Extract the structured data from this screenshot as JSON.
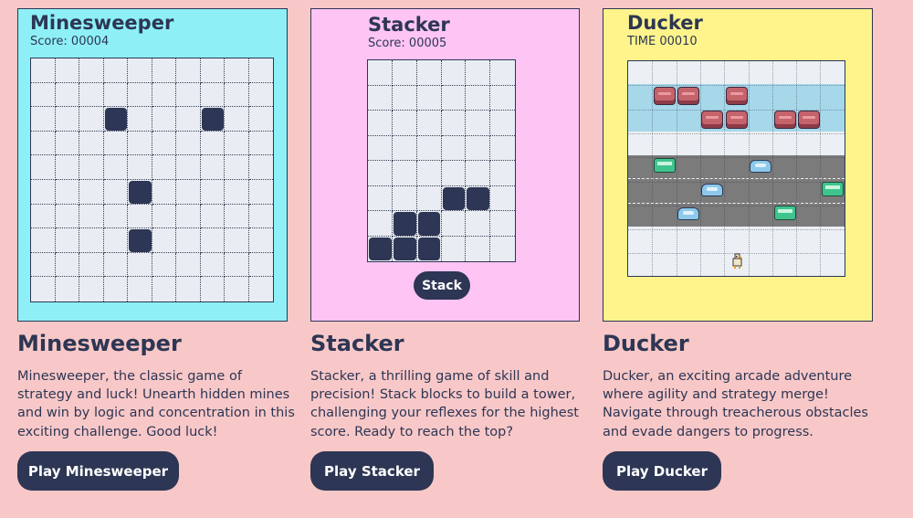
{
  "games": [
    {
      "id": "minesweeper",
      "card_title": "Minesweeper",
      "score_text": "Score: 00004",
      "grid": {
        "cols": 10,
        "rows": 10,
        "filled": [
          [
            2,
            3
          ],
          [
            2,
            7
          ],
          [
            5,
            4
          ],
          [
            7,
            4
          ]
        ]
      },
      "heading": "Minesweeper",
      "description": "Minesweeper, the classic game of strategy and luck! Unearth hidden mines and win by logic and concentration in this exciting challenge. Good luck!",
      "button_label": "Play Minesweeper"
    },
    {
      "id": "stacker",
      "card_title": "Stacker",
      "score_text": "Score: 00005",
      "grid": {
        "cols": 6,
        "rows": 8,
        "filled": [
          [
            5,
            3
          ],
          [
            5,
            4
          ],
          [
            6,
            1
          ],
          [
            6,
            2
          ],
          [
            7,
            0
          ],
          [
            7,
            1
          ],
          [
            7,
            2
          ]
        ]
      },
      "stack_button_label": "Stack",
      "heading": "Stacker",
      "description": "Stacker, a thrilling game of skill and precision! Stack blocks to build a tower, challenging your reflexes for the highest score. Ready to reach the top?",
      "button_label": "Play Stacker"
    },
    {
      "id": "ducker",
      "card_title": "Ducker",
      "score_text": "TIME 00010",
      "heading": "Ducker",
      "description": "Ducker, an exciting arcade adventure where agility and strategy merge! Navigate through treacherous obstacles and evade dangers to progress.",
      "button_label": "Play Ducker"
    }
  ],
  "colors": {
    "background": "#f8c8c8",
    "minesweeper_card": "#8ef0f6",
    "stacker_card": "#fdc4f4",
    "ducker_card": "#fff48c",
    "dark": "#2d3654"
  }
}
